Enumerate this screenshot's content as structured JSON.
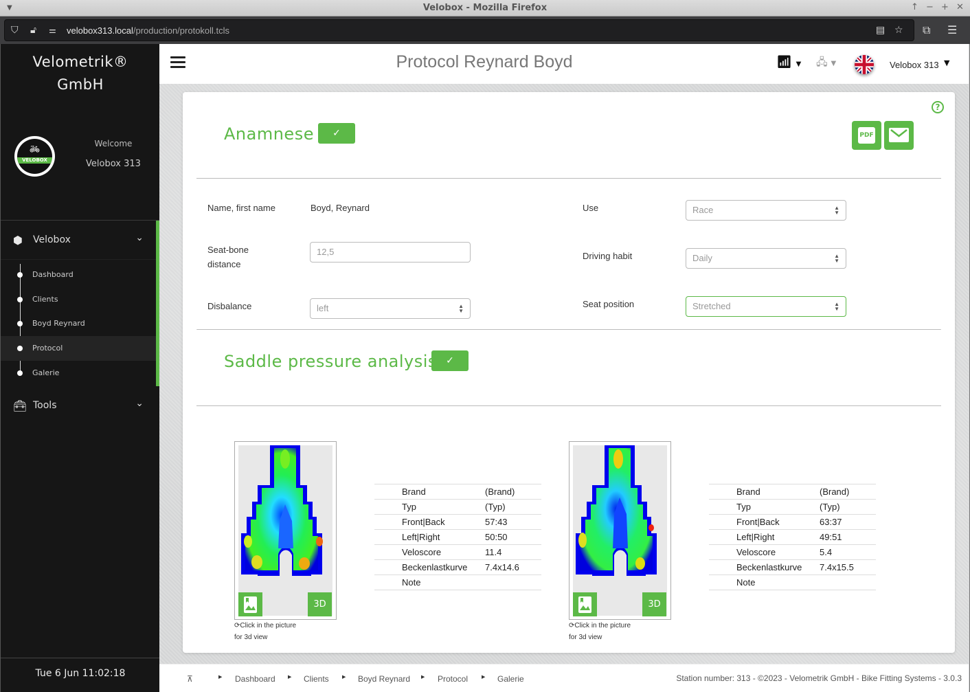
{
  "browser": {
    "window_title": "Velobox - Mozilla Firefox",
    "url_host": "velobox313.local",
    "url_path": "/production/protokoll.tcls"
  },
  "sidebar": {
    "brand_line1": "Velometrik®",
    "brand_line2": "GmbH",
    "logo_text": "VELOBOX",
    "welcome_label": "Welcome",
    "welcome_user": "Velobox 313",
    "groups": [
      {
        "label": "Velobox",
        "icon": "cube-icon",
        "expanded": true
      },
      {
        "label": "Tools",
        "icon": "toolbox-icon",
        "expanded": false
      }
    ],
    "items": [
      {
        "label": "Dashboard",
        "active": false
      },
      {
        "label": "Clients",
        "active": false
      },
      {
        "label": "Boyd Reynard",
        "active": false
      },
      {
        "label": "Protocol",
        "active": true
      },
      {
        "label": "Galerie",
        "active": false
      }
    ],
    "clock": "Tue 6 Jun 11:02:18"
  },
  "topbar": {
    "title": "Protocol Reynard Boyd",
    "user": "Velobox 313",
    "language": "English (UK)"
  },
  "anamnese": {
    "title": "Anamnese",
    "pdf_label": "PDF",
    "fields": {
      "name_label": "Name, first name",
      "name_value": "Boyd, Reynard",
      "seatbone_label_1": "Seat-bone",
      "seatbone_label_2": "distance",
      "seatbone_value": "12,5",
      "disbalance_label": "Disbalance",
      "disbalance_value": "left",
      "use_label": "Use",
      "use_value": "Race",
      "habit_label": "Driving habit",
      "habit_value": "Daily",
      "seatpos_label": "Seat position",
      "seatpos_value": "Stretched"
    }
  },
  "saddle": {
    "title": "Saddle pressure analysis",
    "caption_line1": "Click in the picture",
    "caption_line2": "for 3d view",
    "btn_3d_label": "3D",
    "measurements": [
      {
        "rows": [
          {
            "key": "Brand",
            "value": "(Brand)"
          },
          {
            "key": "Typ",
            "value": "(Typ)"
          },
          {
            "key": "Front|Back",
            "value": "57:43"
          },
          {
            "key": "Left|Right",
            "value": "50:50"
          },
          {
            "key": "Veloscore",
            "value": "11.4"
          },
          {
            "key": "Beckenlastkurve",
            "value": "7.4x14.6"
          },
          {
            "key": "Note",
            "value": ""
          }
        ]
      },
      {
        "rows": [
          {
            "key": "Brand",
            "value": "(Brand)"
          },
          {
            "key": "Typ",
            "value": "(Typ)"
          },
          {
            "key": "Front|Back",
            "value": "63:37"
          },
          {
            "key": "Left|Right",
            "value": "49:51"
          },
          {
            "key": "Veloscore",
            "value": "5.4"
          },
          {
            "key": "Beckenlastkurve",
            "value": "7.4x15.5"
          },
          {
            "key": "Note",
            "value": ""
          }
        ]
      }
    ]
  },
  "footer": {
    "breadcrumb": [
      "Dashboard",
      "Clients",
      "Boyd Reynard",
      "Protocol",
      "Galerie"
    ],
    "info": "Station number: 313 - ©2023 - Velometrik GmbH - Bike Fitting Systems - 3.0.3"
  },
  "colors": {
    "accent": "#5cb947",
    "sidebar_bg": "#161616"
  }
}
